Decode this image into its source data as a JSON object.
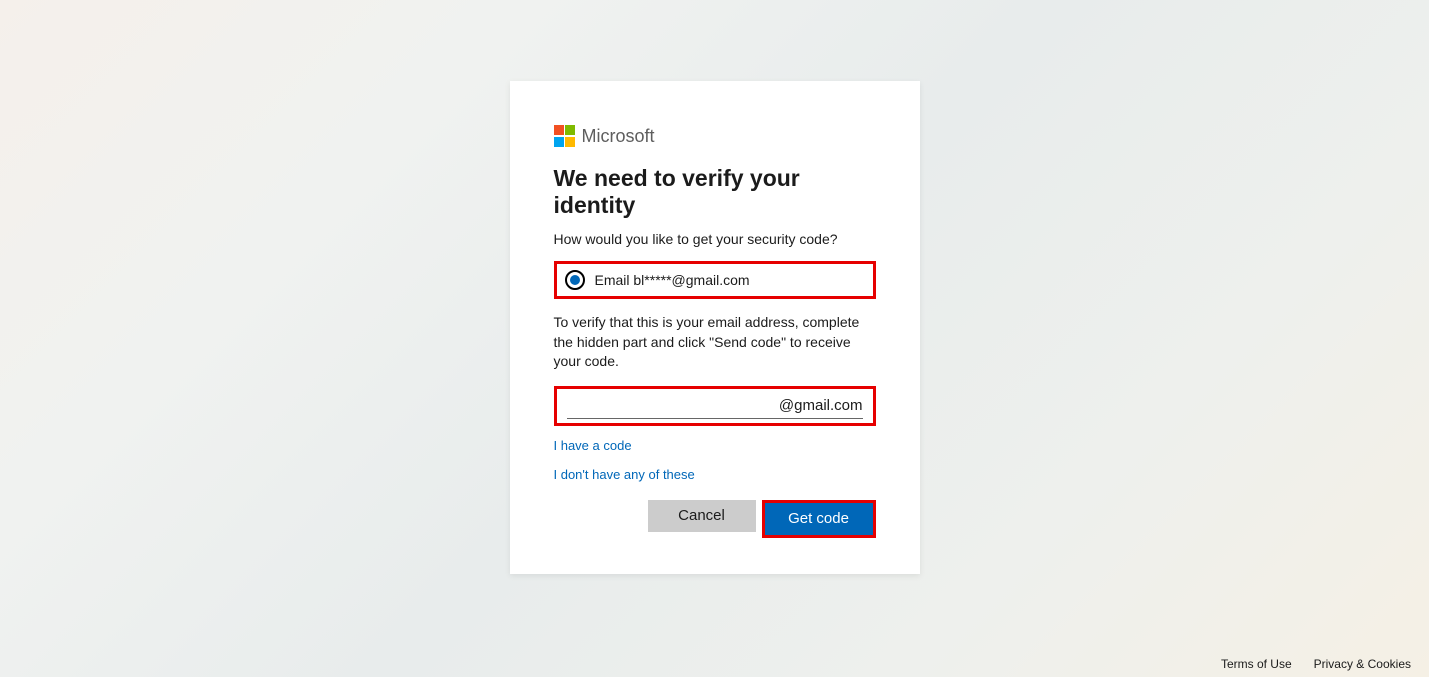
{
  "brand": {
    "name": "Microsoft"
  },
  "card": {
    "title": "We need to verify your identity",
    "subtitle": "How would you like to get your security code?",
    "radio_option": {
      "label": "Email bl*****@gmail.com",
      "selected": true
    },
    "instruction": "To verify that this is your email address, complete the hidden part and click \"Send code\" to receive your code.",
    "email_input": {
      "value": "",
      "suffix": "@gmail.com"
    },
    "link_have_code": "I have a code",
    "link_none": "I don't have any of these",
    "buttons": {
      "cancel": "Cancel",
      "primary": "Get code"
    }
  },
  "footer": {
    "terms": "Terms of Use",
    "privacy": "Privacy & Cookies"
  },
  "highlights": {
    "color": "#e60000"
  }
}
